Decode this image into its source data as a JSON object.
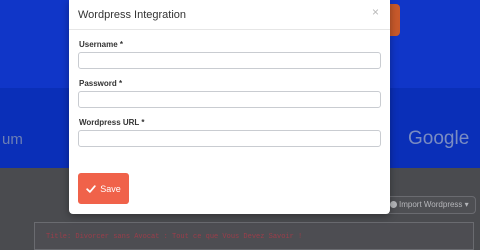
{
  "modal": {
    "title": "Wordpress Integration",
    "close_glyph": "×",
    "fields": [
      {
        "label": "Username *",
        "value": "",
        "placeholder": ""
      },
      {
        "label": "Password *",
        "value": "",
        "placeholder": ""
      },
      {
        "label": "Wordpress URL *",
        "value": "",
        "placeholder": ""
      }
    ],
    "save_label": "Save",
    "save_icon": "check-icon",
    "save_color": "#f0624a"
  },
  "background": {
    "logo_left": "um",
    "logo_right": "Google",
    "import_button": "Import Wordpress",
    "import_caret": "▾",
    "code_text": "Title: Divorcer sans Avocat : Tout ce que Vous Devez Savoir !",
    "hero_color": "#1036c8"
  }
}
